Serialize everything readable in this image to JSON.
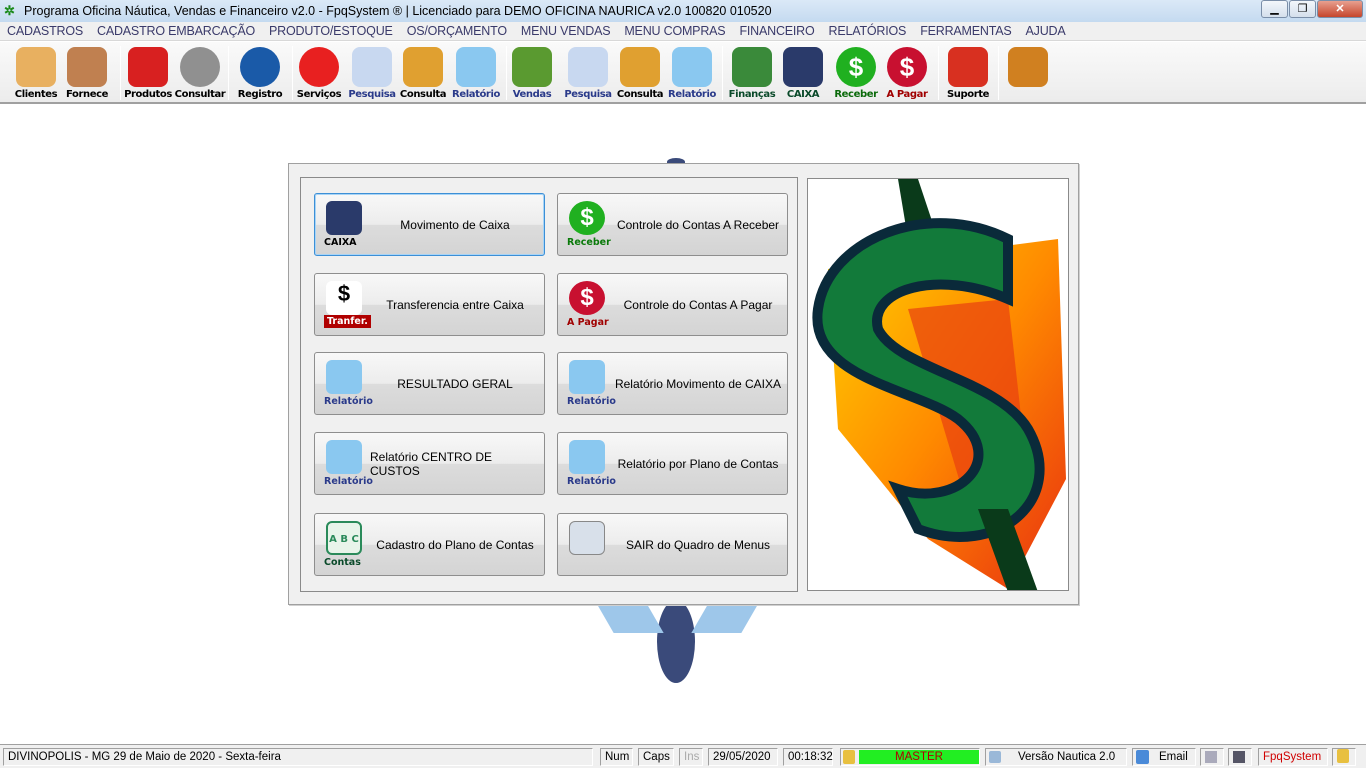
{
  "window": {
    "title": "Programa Oficina Náutica, Vendas e Financeiro v2.0 - FpqSystem ® | Licenciado para  DEMO OFICINA NAURICA v2.0 100820 010520",
    "minimize": "▁",
    "maximize": "❐",
    "close": "✕"
  },
  "menu": [
    "CADASTROS",
    "CADASTRO EMBARCAÇÃO",
    "PRODUTO/ESTOQUE",
    "OS/ORÇAMENTO",
    "MENU VENDAS",
    "MENU COMPRAS",
    "FINANCEIRO",
    "RELATÓRIOS",
    "FERRAMENTAS",
    "AJUDA"
  ],
  "toolbar": [
    {
      "label": "Clientes",
      "color": "#000",
      "icon": "users-icon"
    },
    {
      "label": "Fornece",
      "color": "#000",
      "icon": "supplier-icon"
    },
    {
      "label": "Produtos",
      "color": "#000",
      "icon": "toolbox-icon"
    },
    {
      "label": "Consultar",
      "color": "#000",
      "icon": "barcode-icon"
    },
    {
      "label": "Registro",
      "color": "#000",
      "icon": "sailboat-icon"
    },
    {
      "label": "Serviços",
      "color": "#000",
      "icon": "lifebuoy-icon"
    },
    {
      "label": "Pesquisa",
      "color": "#2a3a8a",
      "icon": "search-doc-icon"
    },
    {
      "label": "Consulta",
      "color": "#000",
      "icon": "file-box-icon"
    },
    {
      "label": "Relatório",
      "color": "#2a3a8a",
      "icon": "printer-icon"
    },
    {
      "label": "Vendas",
      "color": "#2a3a8a",
      "icon": "cart-icon"
    },
    {
      "label": "Pesquisa",
      "color": "#2a3a8a",
      "icon": "search-doc-icon"
    },
    {
      "label": "Consulta",
      "color": "#000",
      "icon": "file-box-icon"
    },
    {
      "label": "Relatório",
      "color": "#2a3a8a",
      "icon": "printer-icon"
    },
    {
      "label": "Finanças",
      "color": "#0a4a2a",
      "icon": "finance-icon"
    },
    {
      "label": "CAIXA",
      "color": "#0a4a2a",
      "icon": "cashbook-icon"
    },
    {
      "label": "Receber",
      "color": "#0a6a0a",
      "icon": "receive-dollar-icon"
    },
    {
      "label": "A Pagar",
      "color": "#a00000",
      "icon": "pay-dollar-icon"
    },
    {
      "label": "Suporte",
      "color": "#000",
      "icon": "support-icon"
    },
    {
      "label": "",
      "color": "#000",
      "icon": "exit-door-icon"
    }
  ],
  "buttons": [
    {
      "text": "Movimento de Caixa",
      "icon_label": "CAIXA",
      "icon_label_color": "#000",
      "icon": "cashbook-icon"
    },
    {
      "text": "Controle do Contas A Receber",
      "icon_label": "Receber",
      "icon_label_color": "#0a7a0a",
      "icon": "receive-dollar-icon"
    },
    {
      "text": "Transferencia entre Caixa",
      "icon_label": "Tranfer.",
      "icon_label_color": "#fff",
      "icon": "transfer-icon"
    },
    {
      "text": "Controle do Contas A Pagar",
      "icon_label": "A Pagar",
      "icon_label_color": "#a00000",
      "icon": "pay-dollar-icon"
    },
    {
      "text": "RESULTADO GERAL",
      "icon_label": "Relatório",
      "icon_label_color": "#2a3a8a",
      "icon": "printer-icon"
    },
    {
      "text": "Relatório Movimento de CAIXA",
      "icon_label": "Relatório",
      "icon_label_color": "#2a3a8a",
      "icon": "printer-icon"
    },
    {
      "text": "Relatório CENTRO DE CUSTOS",
      "icon_label": "Relatório",
      "icon_label_color": "#2a3a8a",
      "icon": "printer-icon"
    },
    {
      "text": "Relatório por Plano de Contas",
      "icon_label": "Relatório",
      "icon_label_color": "#2a3a8a",
      "icon": "printer-icon"
    },
    {
      "text": "Cadastro do Plano de Contas",
      "icon_label": "Contas",
      "icon_label_color": "#0a4a2a",
      "icon": "calendar-abc-icon",
      "icon_text": "A B C"
    },
    {
      "text": "SAIR do Quadro de Menus",
      "icon_label": "",
      "icon_label_color": "#000",
      "icon": "exit-window-icon"
    }
  ],
  "status": {
    "location": "DIVINOPOLIS - MG 29 de Maio de 2020 - Sexta-feira",
    "num": "Num",
    "caps": "Caps",
    "ins": "Ins",
    "date": "29/05/2020",
    "time": "00:18:32",
    "user": "MASTER",
    "version": "Versão Nautica 2.0",
    "email": "Email",
    "brand": "FpqSystem"
  }
}
